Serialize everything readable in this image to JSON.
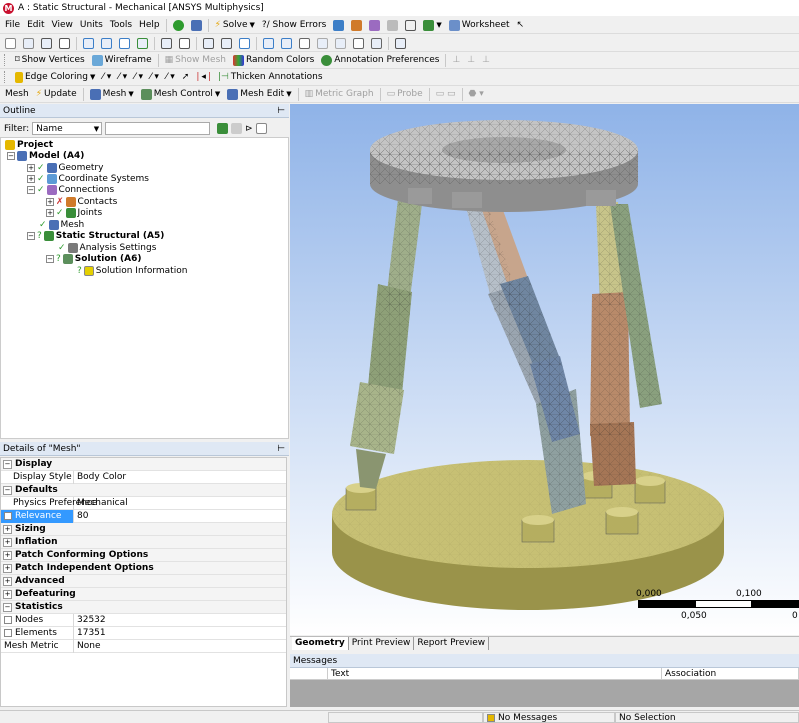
{
  "window": {
    "title": "A : Static Structural - Mechanical [ANSYS Multiphysics]",
    "app_icon": "M"
  },
  "menu": {
    "items": [
      "File",
      "Edit",
      "View",
      "Units",
      "Tools",
      "Help"
    ],
    "solve": "Solve",
    "show_errors": "?/ Show Errors",
    "worksheet": "Worksheet"
  },
  "toolbar2": {
    "icons": [
      "select-vertex-icon",
      "select-edge-icon",
      "select-mode-icon",
      "cursor-icon",
      "box-select-icon",
      "face-select-icon",
      "body-select-icon",
      "extend-select-icon",
      "rotate-icon",
      "pan-icon",
      "zoom-icon",
      "box-zoom-icon",
      "zoom-fit-icon",
      "zoom-selection-icon",
      "magnifier-icon",
      "iso-view-icon",
      "previous-view-icon",
      "next-view-icon",
      "lock-icon",
      "tag-icon",
      "viewports-icon"
    ]
  },
  "toolbar3": {
    "show_vertices": "Show Vertices",
    "wireframe": "Wireframe",
    "show_mesh": "Show Mesh",
    "random_colors": "Random Colors",
    "annotation_preferences": "Annotation Preferences"
  },
  "toolbar4": {
    "edge_coloring": "Edge Coloring",
    "thicken_annotations": "Thicken Annotations"
  },
  "toolbar5": {
    "mesh": "Mesh",
    "update": "Update",
    "mesh_menu": "Mesh",
    "mesh_control": "Mesh Control",
    "mesh_edit": "Mesh Edit",
    "metric_graph": "Metric Graph",
    "probe": "Probe"
  },
  "outline": {
    "title": "Outline",
    "filter_label": "Filter:",
    "filter_value": "Name"
  },
  "tree": [
    {
      "label": "Project",
      "indent": 0,
      "bold": true
    },
    {
      "label": "Model (A4)",
      "indent": 1,
      "bold": true
    },
    {
      "label": "Geometry",
      "indent": 2
    },
    {
      "label": "Coordinate Systems",
      "indent": 2
    },
    {
      "label": "Connections",
      "indent": 2
    },
    {
      "label": "Contacts",
      "indent": 3
    },
    {
      "label": "Joints",
      "indent": 3
    },
    {
      "label": "Mesh",
      "indent": 2
    },
    {
      "label": "Static Structural (A5)",
      "indent": 1,
      "bold": true
    },
    {
      "label": "Analysis Settings",
      "indent": 2
    },
    {
      "label": "Solution (A6)",
      "indent": 2,
      "bold": true
    },
    {
      "label": "Solution Information",
      "indent": 3
    }
  ],
  "details": {
    "title": "Details of \"Mesh\"",
    "rows": [
      {
        "type": "group",
        "label": "Display",
        "expanded": true
      },
      {
        "type": "prop",
        "key": "Display Style",
        "value": "Body Color"
      },
      {
        "type": "group",
        "label": "Defaults",
        "expanded": true
      },
      {
        "type": "prop",
        "key": "Physics Preference",
        "value": "Mechanical"
      },
      {
        "type": "prop",
        "key": "Relevance",
        "value": "80",
        "checkbox": true,
        "selected": true
      },
      {
        "type": "group",
        "label": "Sizing",
        "expanded": false
      },
      {
        "type": "group",
        "label": "Inflation",
        "expanded": false
      },
      {
        "type": "group",
        "label": "Patch Conforming Options",
        "expanded": false
      },
      {
        "type": "group",
        "label": "Patch Independent Options",
        "expanded": false
      },
      {
        "type": "group",
        "label": "Advanced",
        "expanded": false
      },
      {
        "type": "group",
        "label": "Defeaturing",
        "expanded": false
      },
      {
        "type": "group",
        "label": "Statistics",
        "expanded": true
      },
      {
        "type": "prop",
        "key": "Nodes",
        "value": "32532",
        "checkbox": true
      },
      {
        "type": "prop",
        "key": "Elements",
        "value": "17351",
        "checkbox": true
      },
      {
        "type": "prop",
        "key": "Mesh Metric",
        "value": "None"
      }
    ]
  },
  "scale": {
    "labels_top": [
      "0,000",
      "0,100"
    ],
    "labels_bottom": [
      "0,050",
      "0"
    ]
  },
  "tabs": [
    "Geometry",
    "Print Preview",
    "Report Preview"
  ],
  "messages": {
    "title": "Messages",
    "columns": [
      "Text",
      "Association"
    ]
  },
  "status": {
    "messages": "No Messages",
    "selection": "No Selection"
  }
}
